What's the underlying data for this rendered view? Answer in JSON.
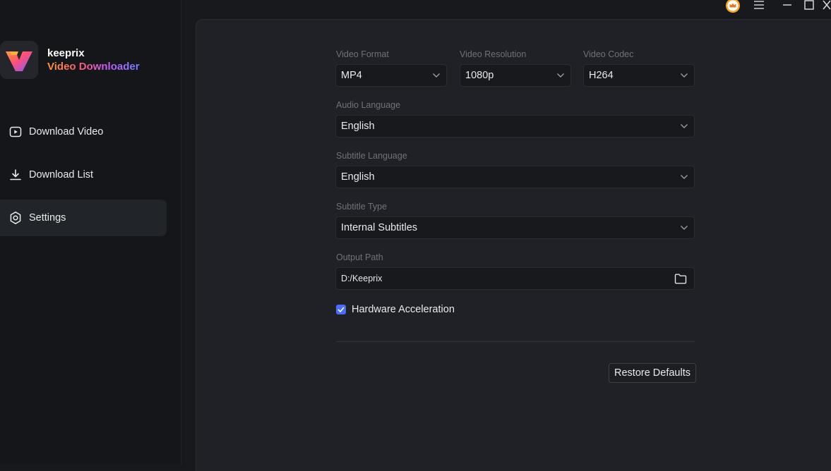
{
  "app": {
    "brand": "keeprix",
    "product": "Video Downloader"
  },
  "sidebar": {
    "items": [
      {
        "label": "Download Video",
        "icon": "play-square-icon",
        "active": false
      },
      {
        "label": "Download List",
        "icon": "download-icon",
        "active": false
      },
      {
        "label": "Settings",
        "icon": "settings-gear-icon",
        "active": true
      }
    ]
  },
  "titlebar": {
    "icons": [
      "crown-premium-icon",
      "hamburger-menu-icon",
      "minimize-icon",
      "maximize-icon",
      "close-icon"
    ]
  },
  "settings": {
    "video_format": {
      "label": "Video Format",
      "value": "MP4"
    },
    "video_resolution": {
      "label": "Video Resolution",
      "value": "1080p"
    },
    "video_codec": {
      "label": "Video Codec",
      "value": "H264"
    },
    "audio_language": {
      "label": "Audio Language",
      "value": "English"
    },
    "subtitle_language": {
      "label": "Subtitle Language",
      "value": "English"
    },
    "subtitle_type": {
      "label": "Subtitle Type",
      "value": "Internal Subtitles"
    },
    "output_path": {
      "label": "Output Path",
      "value": "D:/Keeprix"
    },
    "hardware_acceleration": {
      "label": "Hardware Acceleration",
      "checked": true
    },
    "restore_defaults": "Restore Defaults"
  },
  "colors": {
    "accent": "#4b6cf5",
    "background": "#17191d",
    "panel": "#1f2126",
    "sidebar": "#141619"
  }
}
